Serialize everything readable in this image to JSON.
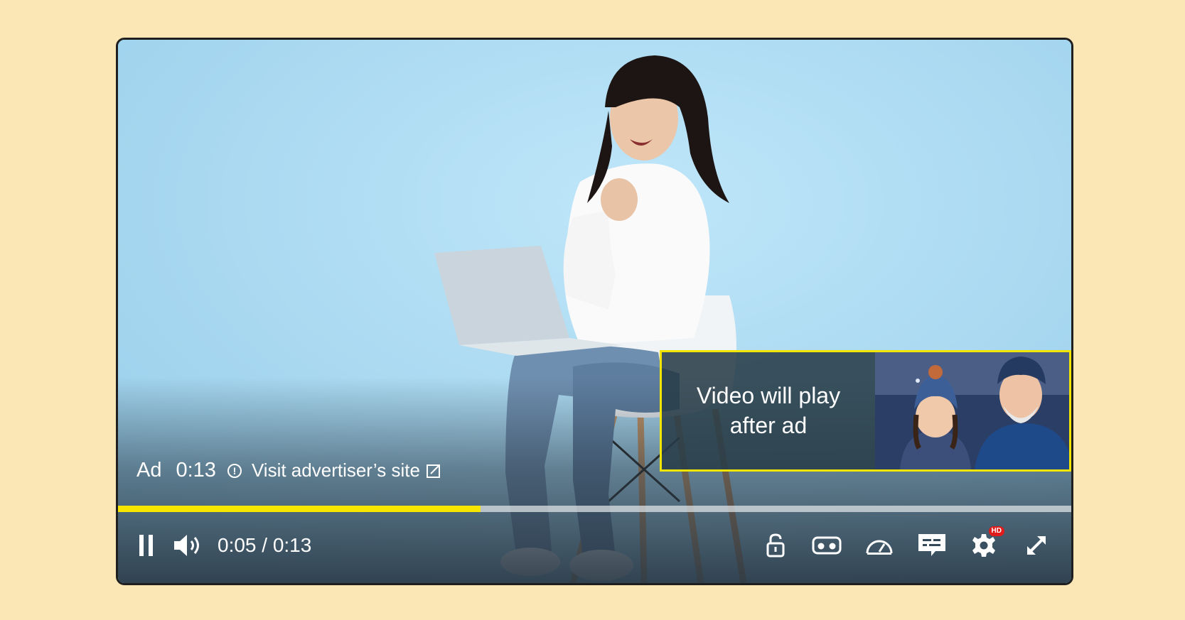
{
  "ad": {
    "label": "Ad",
    "remaining": "0:13",
    "visit_label": "Visit advertiser’s site"
  },
  "preview": {
    "text": "Video will play after ad"
  },
  "progress": {
    "fraction": 0.38
  },
  "controls": {
    "time": "0:05 / 0:13",
    "icons": [
      "pause-icon",
      "volume-icon",
      "unlock-icon",
      "vr-headset-icon",
      "speed-gauge-icon",
      "captions-icon",
      "settings-gear-icon",
      "fullscreen-icon"
    ],
    "hd_badge": "HD"
  },
  "colors": {
    "accent": "#f7e600",
    "background": "#fae7b5",
    "badge": "#e01b1b"
  }
}
